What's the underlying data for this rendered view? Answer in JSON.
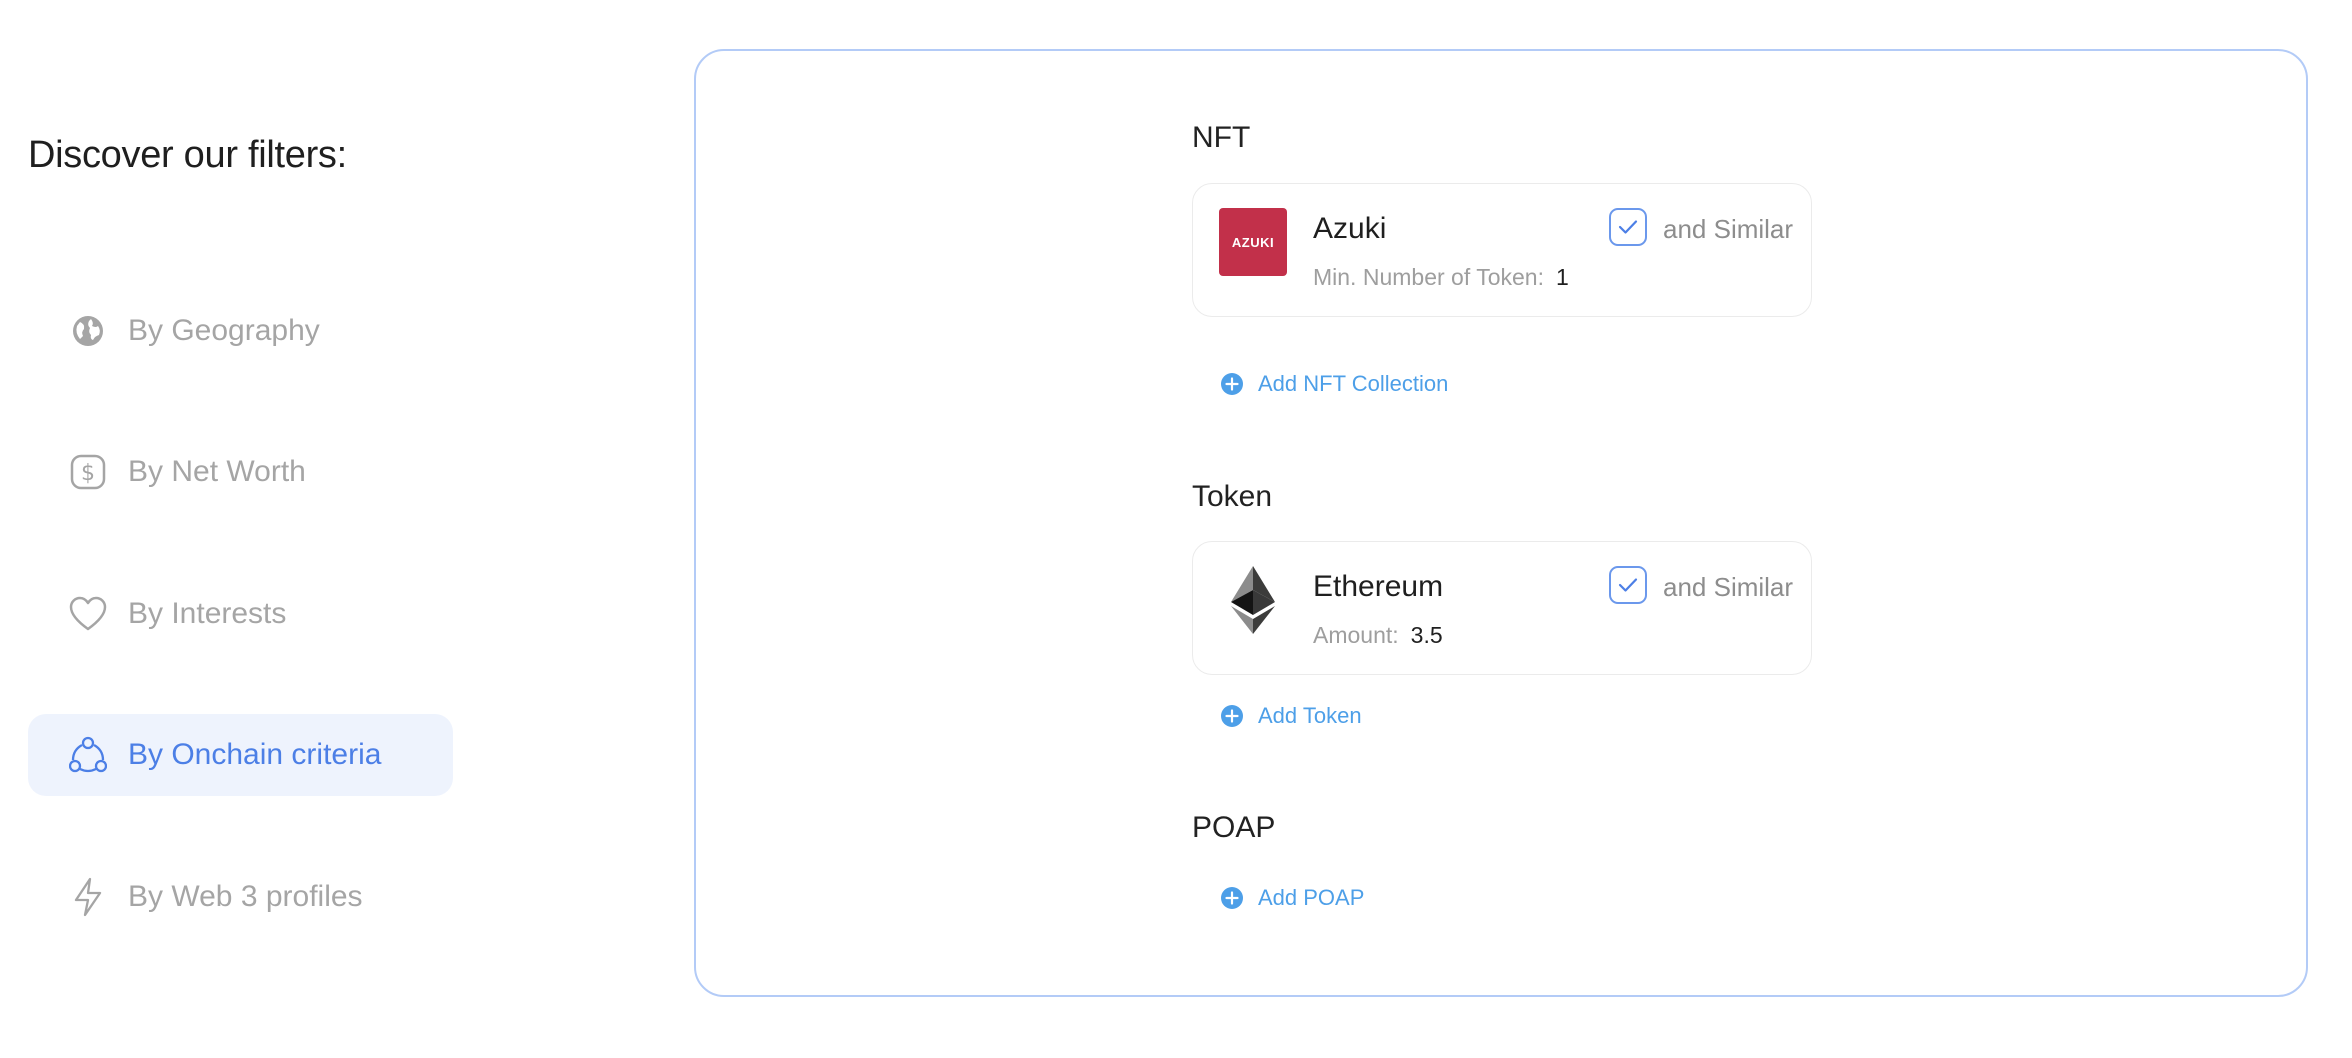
{
  "page": {
    "heading": "Discover our filters:"
  },
  "sidebar": {
    "items": [
      {
        "label": "By Geography",
        "icon": "globe-icon",
        "active": false
      },
      {
        "label": "By Net Worth",
        "icon": "dollar-icon",
        "active": false
      },
      {
        "label": "By Interests",
        "icon": "heart-icon",
        "active": false
      },
      {
        "label": "By Onchain criteria",
        "icon": "network-icon",
        "active": true
      },
      {
        "label": "By Web 3 profiles",
        "icon": "lightning-icon",
        "active": false
      }
    ]
  },
  "sections": {
    "nft": {
      "title": "NFT",
      "card": {
        "logo_text": "AZUKI",
        "name": "Azuki",
        "meta_label": "Min. Number of Token:",
        "meta_value": "1",
        "similar_label": "and Similar",
        "similar_checked": true
      },
      "add_label": "Add NFT Collection"
    },
    "token": {
      "title": "Token",
      "card": {
        "name": "Ethereum",
        "meta_label": "Amount:",
        "meta_value": "3.5",
        "similar_label": "and Similar",
        "similar_checked": true
      },
      "add_label": "Add Token"
    },
    "poap": {
      "title": "POAP",
      "add_label": "Add POAP"
    }
  },
  "colors": {
    "accent": "#4c7fe6",
    "active_bg": "#eef3fd",
    "panel_border": "#b3cbf7",
    "link": "#4d9fe8",
    "azuki_red": "#c2304a"
  }
}
